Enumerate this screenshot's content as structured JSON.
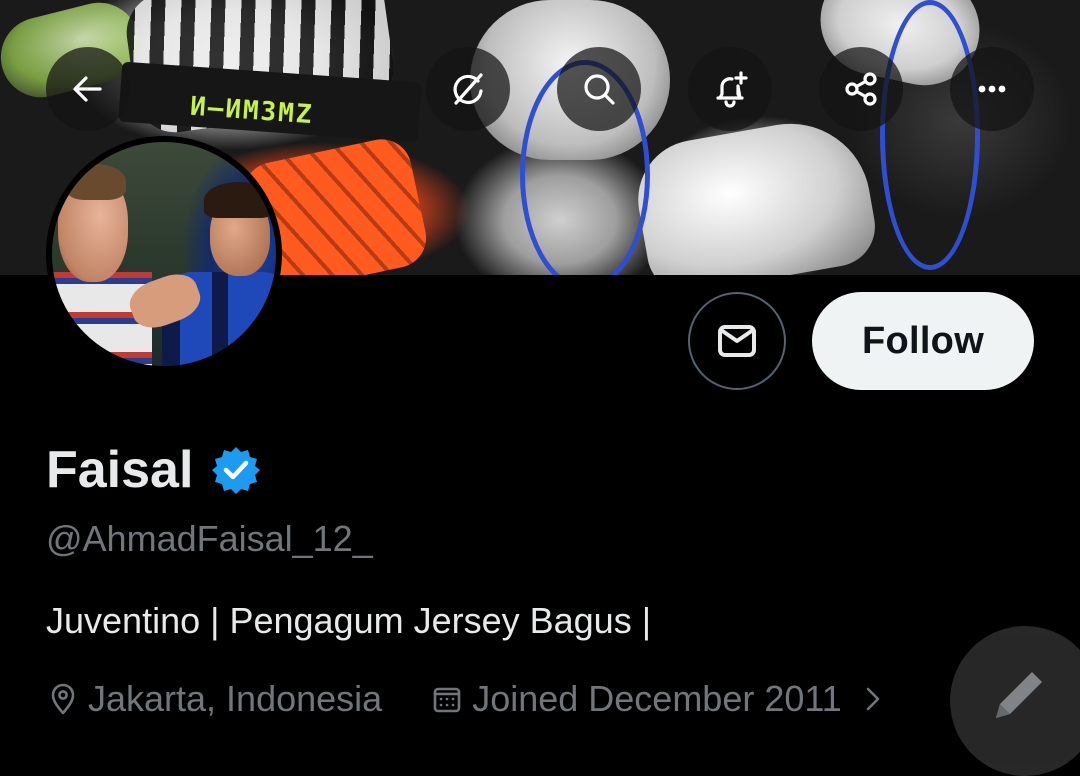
{
  "header": {
    "buttons": [
      {
        "name": "back-button",
        "icon": "arrow-left-icon"
      },
      {
        "name": "grok-button",
        "icon": "grok-icon"
      },
      {
        "name": "search-button",
        "icon": "search-icon"
      },
      {
        "name": "notify-button",
        "icon": "bell-plus-icon"
      },
      {
        "name": "share-button",
        "icon": "share-icon"
      },
      {
        "name": "more-button",
        "icon": "more-horizontal-icon"
      }
    ]
  },
  "banner": {
    "text": "И—ИМЗМZ"
  },
  "actions": {
    "message_icon": "mail-icon",
    "follow_label": "Follow"
  },
  "profile": {
    "name": "Faisal",
    "verified_icon": "verified-badge-icon",
    "handle": "@AhmadFaisal_12_",
    "bio": "Juventino | Pengagum Jersey Bagus |",
    "location": "Jakarta, Indonesia",
    "joined": "Joined December 2011"
  },
  "fab": {
    "icon": "compose-pencil-icon"
  },
  "colors": {
    "background": "#000000",
    "primary_text": "#e7e9ea",
    "secondary_text": "#71767b",
    "verified_blue": "#1d9bf0",
    "follow_bg": "#eff3f4",
    "border": "#536471"
  }
}
